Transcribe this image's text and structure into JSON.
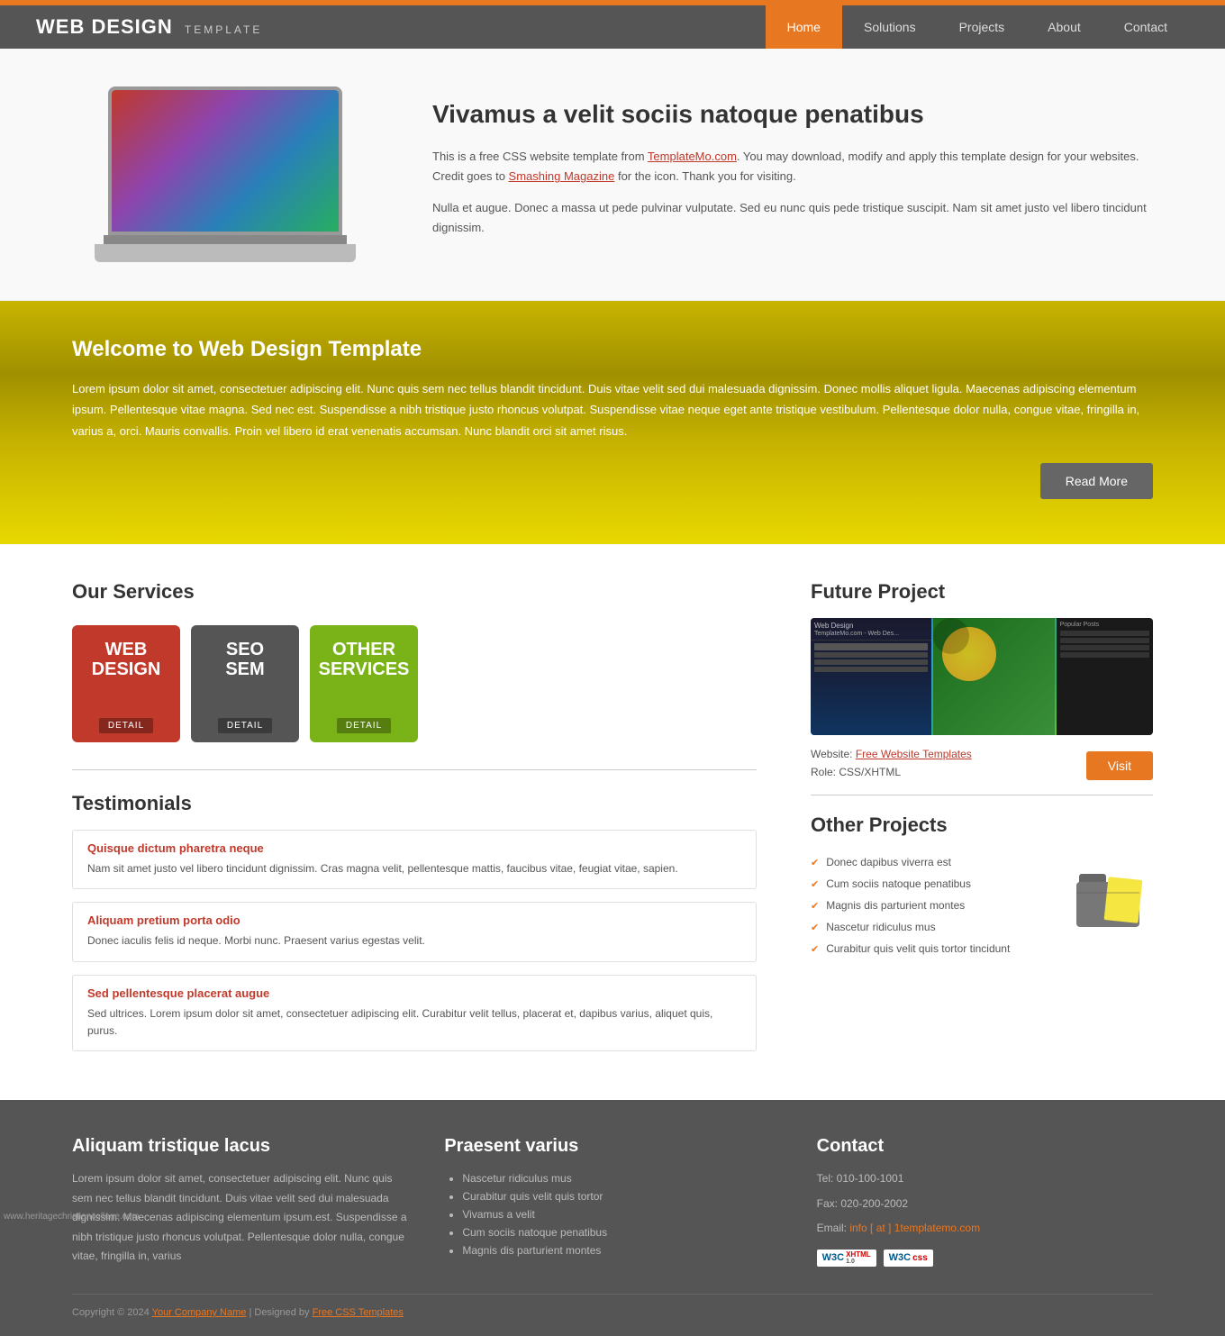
{
  "topbar": {},
  "header": {
    "logo_bold": "WEB DESIGN",
    "logo_sub": "TEMPLATE",
    "nav": [
      {
        "label": "Home",
        "active": true
      },
      {
        "label": "Solutions",
        "active": false
      },
      {
        "label": "Projects",
        "active": false
      },
      {
        "label": "About",
        "active": false
      },
      {
        "label": "Contact",
        "active": false
      }
    ]
  },
  "hero": {
    "title": "Vivamus a velit sociis natoque penatibus",
    "para1": "This is a free CSS website template from TemplateMo.com. You may download, modify and apply this template design for your websites. Credit goes to Smashing Magazine for the icon. Thank you for visiting.",
    "para2": "Nulla et augue. Donec a massa ut pede pulvinar vulputate. Sed eu nunc quis pede tristique suscipit. Nam sit amet justo vel libero tincidunt dignissim.",
    "templatemo_link": "TemplateMo.com",
    "smashing_link": "Smashing Magazine"
  },
  "welcome": {
    "title": "Welcome to Web Design Template",
    "body": "Lorem ipsum dolor sit amet, consectetuer adipiscing elit. Nunc quis sem nec tellus blandit tincidunt. Duis vitae velit sed dui malesuada dignissim. Donec mollis aliquet ligula. Maecenas adipiscing elementum ipsum. Pellentesque vitae magna. Sed nec est. Suspendisse a nibh tristique justo rhoncus volutpat. Suspendisse vitae neque eget ante tristique vestibulum. Pellentesque dolor nulla, congue vitae, fringilla in, varius a, orci. Mauris convallis. Proin vel libero id erat venenatis accumsan. Nunc blandit orci sit amet risus.",
    "read_more": "Read More"
  },
  "services": {
    "title": "Our Services",
    "cards": [
      {
        "label_line1": "WEB",
        "label_line2": "Design",
        "detail": "DETAIL",
        "type": "web"
      },
      {
        "label_line1": "SEO",
        "label_line2": "SEM",
        "detail": "DETAIL",
        "type": "seo"
      },
      {
        "label_line1": "OTHER",
        "label_line2": "Services",
        "detail": "DETAIL",
        "type": "other"
      }
    ]
  },
  "testimonials": {
    "title": "Testimonials",
    "items": [
      {
        "heading": "Quisque dictum pharetra neque",
        "body": "Nam sit amet justo vel libero tincidunt dignissim. Cras magna velit, pellentesque mattis, faucibus vitae, feugiat vitae, sapien."
      },
      {
        "heading": "Aliquam pretium porta odio",
        "body": "Donec iaculis felis id neque. Morbi nunc. Praesent varius egestas velit."
      },
      {
        "heading": "Sed pellentesque placerat augue",
        "body": "Sed ultrices. Lorem ipsum dolor sit amet, consectetuer adipiscing elit. Curabitur velit tellus, placerat et, dapibus varius, aliquet quis, purus."
      }
    ]
  },
  "future_project": {
    "title": "Future Project",
    "website_label": "Website:",
    "website_link": "Free Website Templates",
    "role_label": "Role: CSS/XHTML",
    "visit_btn": "Visit"
  },
  "other_projects": {
    "title": "Other Projects",
    "items": [
      "Donec dapibus viverra est",
      "Cum sociis natoque penatibus",
      "Magnis dis parturient montes",
      "Nascetur ridiculus mus",
      "Curabitur quis velit quis tortor tincidunt"
    ]
  },
  "footer": {
    "col1": {
      "title": "Aliquam tristique lacus",
      "body": "Lorem ipsum dolor sit amet, consectetuer adipiscing elit. Nunc quis sem nec tellus blandit tincidunt. Duis vitae velit sed dui malesuada dignissim. Maecenas adipiscing elementum ipsum.est. Suspendisse a nibh tristique justo rhoncus volutpat. Pellentesque dolor nulla, congue vitae, fringilla in, varius"
    },
    "col2": {
      "title": "Praesent varius",
      "items": [
        "Nascetur ridiculus mus",
        "Curabitur quis velit quis tortor",
        "Vivamus a velit",
        "Cum sociis natoque penatibus",
        "Magnis dis parturient montes"
      ]
    },
    "col3": {
      "title": "Contact",
      "tel": "Tel: 010-100-1001",
      "fax": "Fax: 020-200-2002",
      "email_label": "Email:",
      "email_link": "info [ at ] 1templatemo.com"
    },
    "copyright": "Copyright © 2024",
    "company_link": "Your Company Name",
    "designed_by": "Designed by",
    "css_link": "Free CSS Templates",
    "site_url": "www.heritagechristiancollege.com"
  }
}
